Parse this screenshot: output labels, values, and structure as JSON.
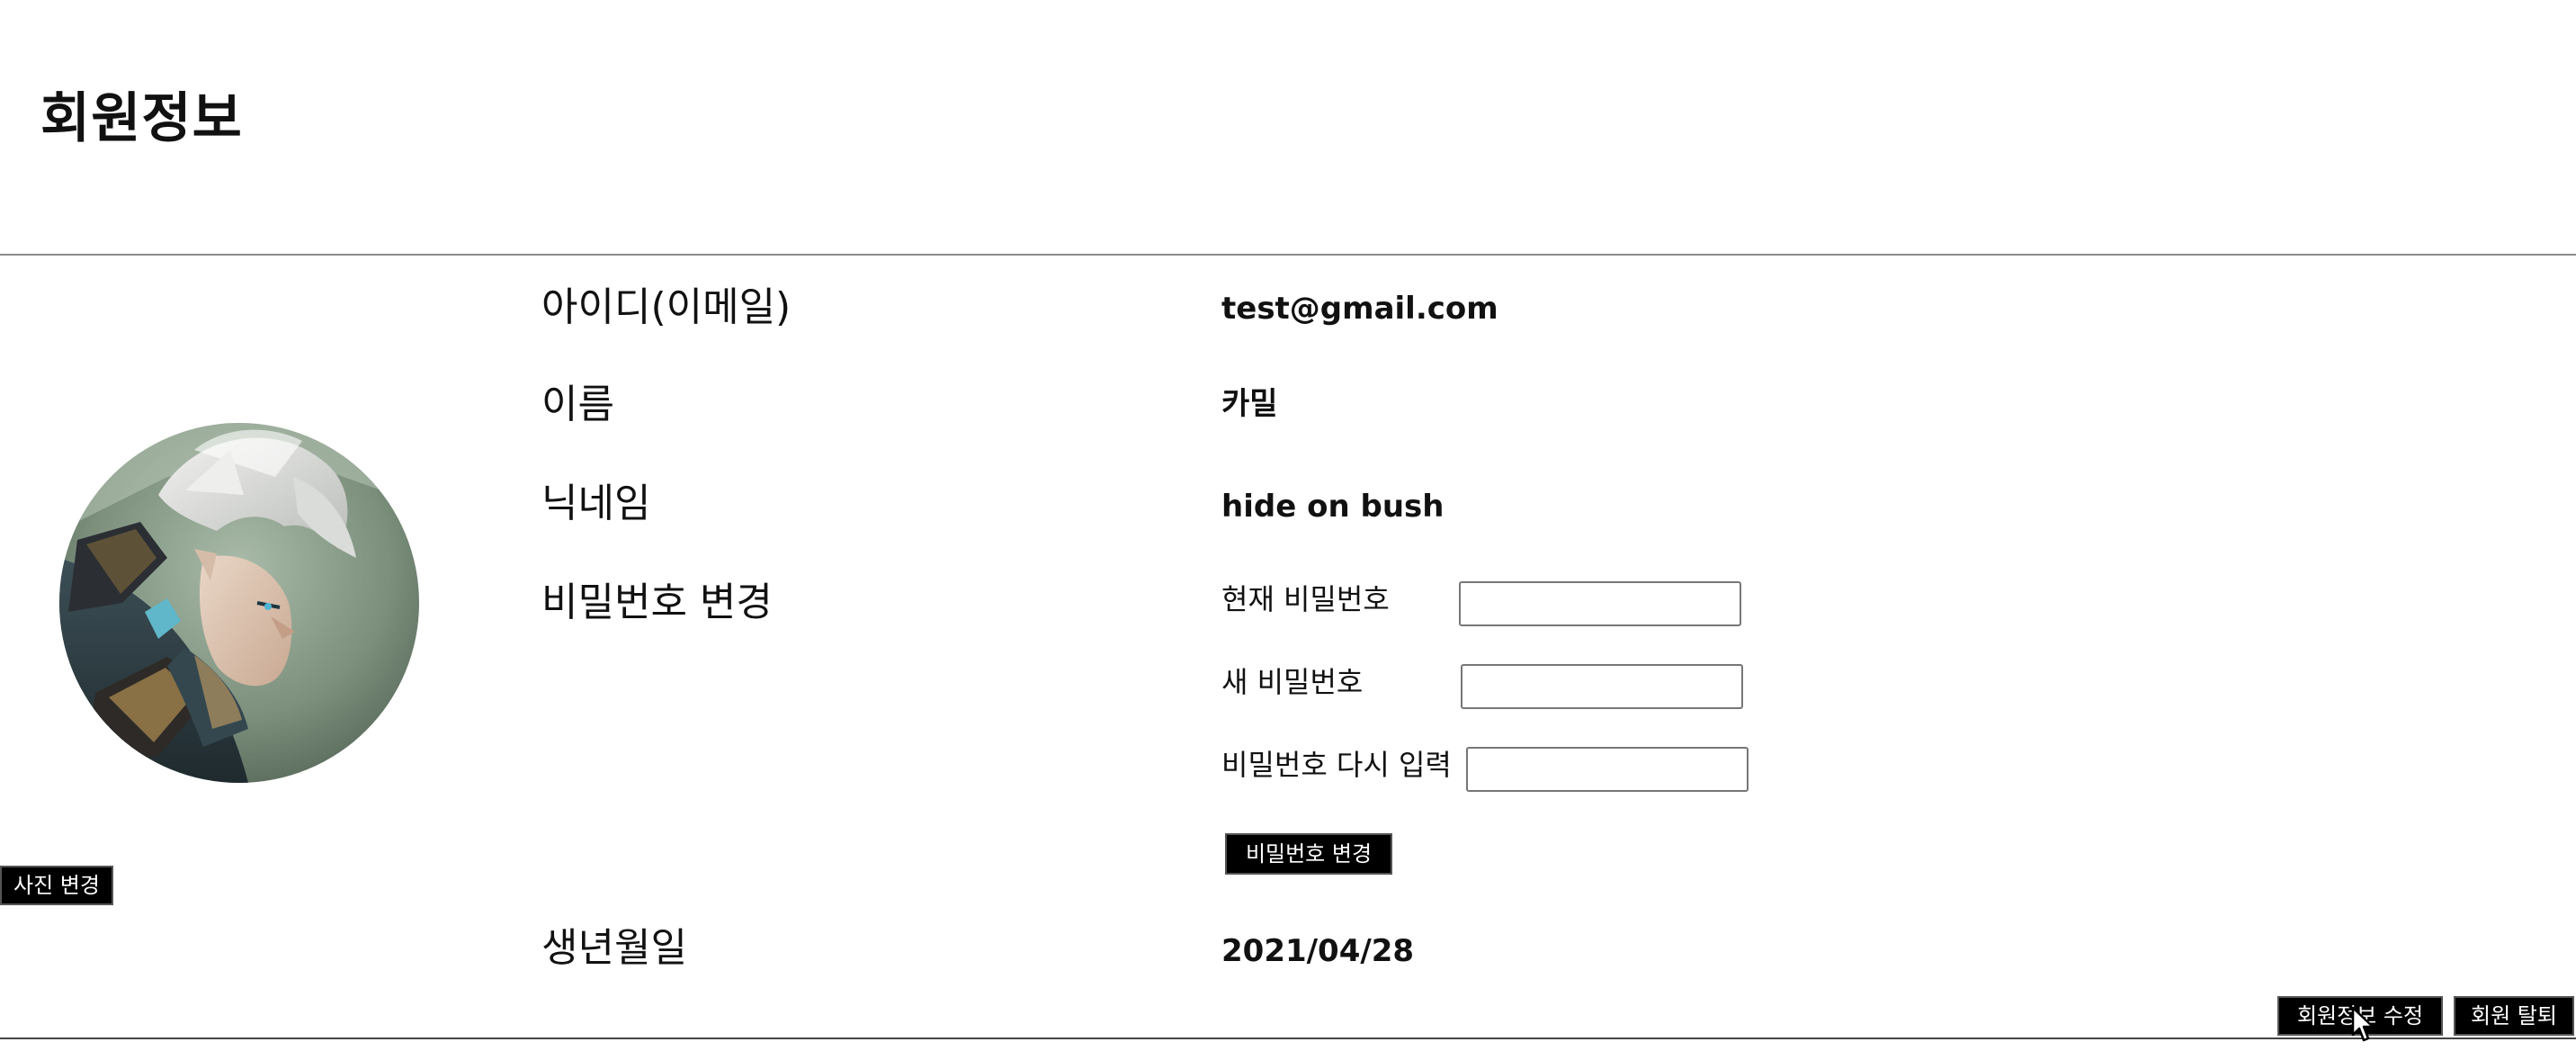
{
  "page": {
    "title": "회원정보"
  },
  "profile": {
    "avatar_alt": "profile photo",
    "change_photo_label": "사진 변경"
  },
  "fields": {
    "email_label": "아이디(이메일)",
    "email_value": "test@gmail.com",
    "name_label": "이름",
    "name_value": "카밀",
    "nickname_label": "닉네임",
    "nickname_value": "hide on bush",
    "password_label": "비밀번호 변경",
    "birthday_label": "생년월일",
    "birthday_value": "2021/04/28"
  },
  "password_form": {
    "current_label": "현재 비밀번호",
    "current_value": "",
    "new_label": "새 비밀번호",
    "new_value": "",
    "confirm_label": "비밀번호 다시 입력",
    "confirm_value": "",
    "submit_label": "비밀번호 변경"
  },
  "actions": {
    "edit_label": "회원정보 수정",
    "withdraw_label": "회원 탈퇴"
  },
  "colors": {
    "button_bg": "#000000",
    "button_text": "#ffffff",
    "divider": "#8a8a8a"
  }
}
